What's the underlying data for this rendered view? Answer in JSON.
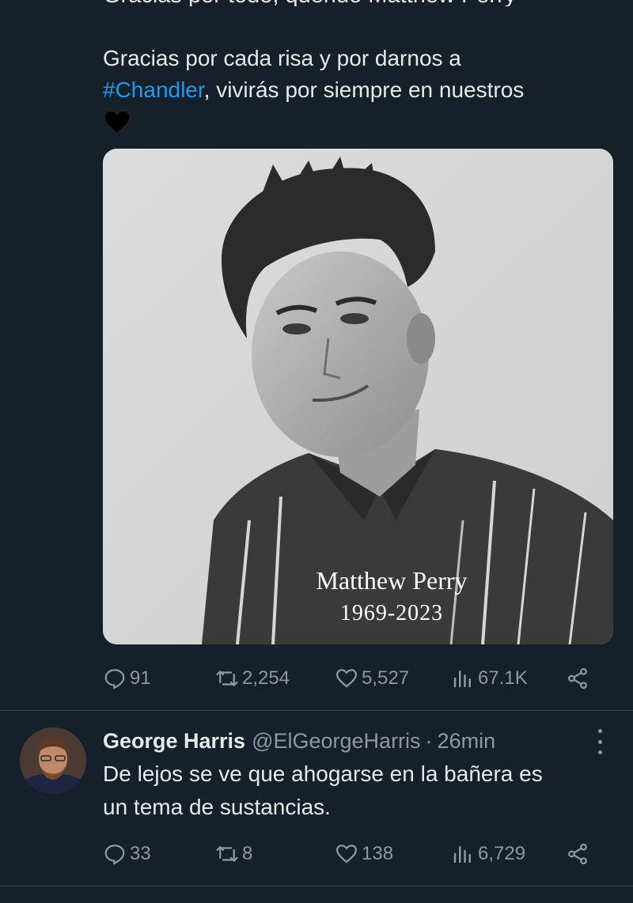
{
  "tweet": {
    "cutoff_text": "Gracias por todo, querido Matthew Perry",
    "cutoff_hashtag": "",
    "text_line1": "Gracias por cada risa y por darnos a",
    "hashtag": "#Chandler",
    "text_line2_rest": ", vivirás por siempre en nuestros",
    "heart_emoji": "black-heart-icon",
    "media": {
      "caption_name": "Matthew Perry",
      "caption_years": "1969-2023"
    },
    "actions": {
      "replies": "91",
      "retweets": "2,254",
      "likes": "5,527",
      "views": "67.1K"
    }
  },
  "reply": {
    "name": "George Harris",
    "handle": "@ElGeorgeHarris",
    "separator": "·",
    "time": "26min",
    "text_line1": "De lejos se ve que ahogarse en la bañera es",
    "text_line2": "un tema de sustancias.",
    "actions": {
      "replies": "33",
      "retweets": "8",
      "likes": "138",
      "views": "6,729"
    }
  },
  "colors": {
    "background": "#15202b",
    "text": "#e7e9ea",
    "muted": "#8b98a5",
    "link": "#1d9bf0",
    "divider": "#38444d"
  }
}
